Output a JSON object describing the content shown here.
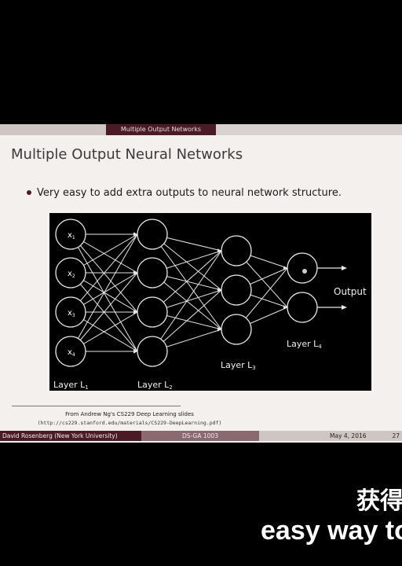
{
  "header": {
    "section_title": "Multiple Output Networks"
  },
  "slide": {
    "title": "Multiple Output Neural Networks",
    "bullet": "Very easy to add extra outputs to neural network structure."
  },
  "figure": {
    "inputs": [
      "x",
      "x",
      "x",
      "x"
    ],
    "input_subscripts": [
      "1",
      "2",
      "3",
      "4"
    ],
    "output_label": "Output",
    "layer_labels": [
      {
        "text": "Layer L",
        "sub": "1"
      },
      {
        "text": "Layer L",
        "sub": "2"
      },
      {
        "text": "Layer L",
        "sub": "3"
      },
      {
        "text": "Layer L",
        "sub": "4"
      }
    ]
  },
  "footnote": {
    "line1": "From Andrew Ng's CS229 Deep Learning slides",
    "line2": "(http://cs229.stanford.edu/materials/CS229-DeepLearning.pdf)"
  },
  "footer": {
    "author": "David Rosenberg  (New York University)",
    "course": "DS-GA 1003",
    "date": "May 4, 2016",
    "page": "27"
  },
  "subtitles": {
    "line1": "获得",
    "line2": "easy way to"
  },
  "colors": {
    "accent": "#4a1a26",
    "background": "#000000",
    "slide_bg": "#f3f0ee"
  }
}
